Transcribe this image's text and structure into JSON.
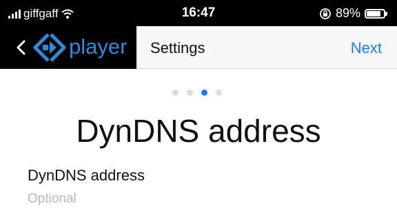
{
  "status_bar": {
    "carrier": "giffgaff",
    "time": "16:47",
    "battery_percent_text": "89%",
    "battery_level": 0.89,
    "icons": [
      "signal-icon",
      "wifi-icon",
      "orientation-lock-icon",
      "battery-icon"
    ]
  },
  "app_bar": {
    "logo_text": "player",
    "title": "Settings",
    "next_label": "Next",
    "colors": {
      "accent": "#1a7cf0",
      "logo": "#2e8bd8"
    }
  },
  "pager": {
    "total": 4,
    "current": 3
  },
  "main": {
    "heading": "DynDNS address",
    "field_label": "DynDNS address",
    "field_value": "",
    "field_placeholder": "Optional"
  }
}
